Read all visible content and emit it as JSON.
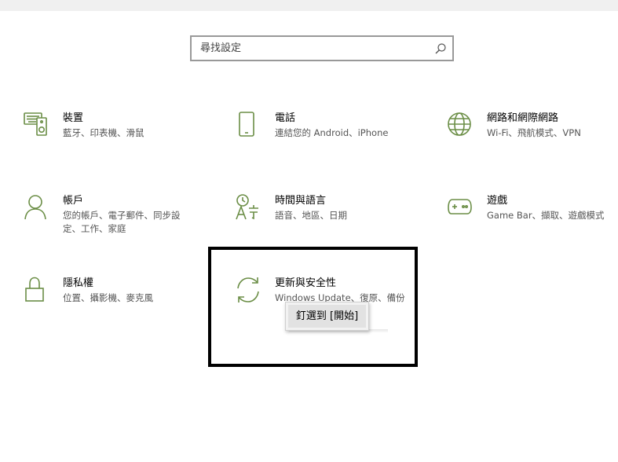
{
  "search": {
    "placeholder": "尋找設定"
  },
  "tiles": [
    {
      "icon": "keyboard-speaker-icon",
      "title": "裝置",
      "desc": "藍牙、印表機、滑鼠"
    },
    {
      "icon": "phone-icon",
      "title": "電話",
      "desc": "連結您的 Android、iPhone"
    },
    {
      "icon": "globe-icon",
      "title": "網路和網際網路",
      "desc": "Wi-Fi、飛航模式、VPN"
    },
    {
      "icon": "person-icon",
      "title": "帳戶",
      "desc": "您的帳戶、電子郵件、同步設定、工作、家庭"
    },
    {
      "icon": "language-icon",
      "title": "時間與語言",
      "desc": "語音、地區、日期"
    },
    {
      "icon": "game-controller-icon",
      "title": "遊戲",
      "desc": "Game Bar、擷取、遊戲模式"
    },
    {
      "icon": "lock-icon",
      "title": "隱私權",
      "desc": "位置、攝影機、麥克風"
    },
    {
      "icon": "refresh-icon",
      "title": "更新與安全性",
      "desc": "Windows Update、復原、備份"
    }
  ],
  "context_menu": {
    "items": [
      {
        "label": "釘選到 [開始]"
      }
    ]
  },
  "colors": {
    "accent": "#6b8e46",
    "focus_border": "#000000"
  }
}
